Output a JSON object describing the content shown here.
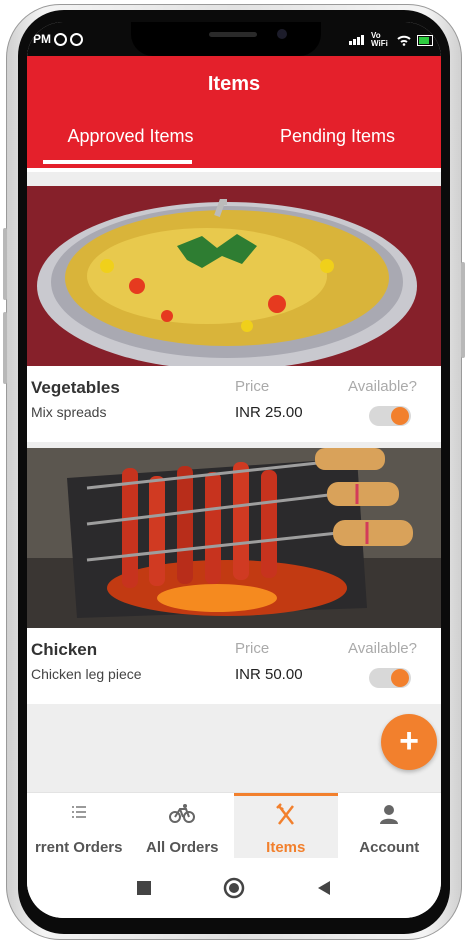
{
  "status": {
    "time": "PM",
    "network": "Vo WiFi"
  },
  "appbar": {
    "title": "Items"
  },
  "tabs": [
    {
      "label": "Approved Items",
      "active": true
    },
    {
      "label": "Pending Items",
      "active": false
    }
  ],
  "items": [
    {
      "name": "Vegetables",
      "description": "Mix spreads",
      "price_label": "Price",
      "price": "INR 25.00",
      "available_label": "Available?",
      "available": true,
      "image": "vegetable-mix-spread-plate"
    },
    {
      "name": "Chicken",
      "description": "Chicken leg piece",
      "price_label": "Price",
      "price": "INR 50.00",
      "available_label": "Available?",
      "available": true,
      "image": "chicken-skewers-on-grill"
    }
  ],
  "fab": {
    "label": "+"
  },
  "bottom_nav": [
    {
      "label": "Current Orders",
      "visible_label": "rrent Orders",
      "icon": "list-icon"
    },
    {
      "label": "All Orders",
      "icon": "bicycle-icon"
    },
    {
      "label": "Items",
      "icon": "fork-knife-icon",
      "active": true
    },
    {
      "label": "Account",
      "icon": "person-icon"
    }
  ],
  "colors": {
    "primary": "#e4202b",
    "accent": "#f2802d",
    "background": "#eeeeee"
  }
}
